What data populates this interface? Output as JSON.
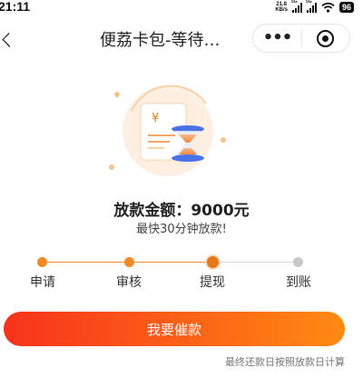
{
  "status_bar": {
    "time": "21:11",
    "net_speed_value": "21.8",
    "net_speed_unit": "KB/s",
    "signal_1_tag": "5G",
    "signal_2_tag": "5G",
    "battery": "96",
    "icons": [
      "signal-icon",
      "signal-icon",
      "wifi-icon",
      "battery-icon"
    ]
  },
  "nav": {
    "close_glyph": "ㄑ",
    "title": "便荔卡包-等待…",
    "more_icon": "more-dots-icon",
    "target_icon": "target-icon"
  },
  "illustration": {
    "icons": [
      "receipt-icon",
      "hourglass-icon"
    ],
    "currency_symbol": "¥"
  },
  "amount": {
    "text": "放款金额：9000元",
    "subtext": "最快30分钟放款!"
  },
  "steps": [
    {
      "label": "申请",
      "state": "done"
    },
    {
      "label": "审核",
      "state": "done"
    },
    {
      "label": "提现",
      "state": "current"
    },
    {
      "label": "到账",
      "state": "pending"
    }
  ],
  "colors": {
    "accent": "#f08a28",
    "button_start": "#f8331c",
    "button_end": "#ff8a12",
    "pending": "#c8c8c8"
  },
  "button": {
    "label": "我要催款"
  },
  "footnote": "最终还款日按照放款日计算"
}
